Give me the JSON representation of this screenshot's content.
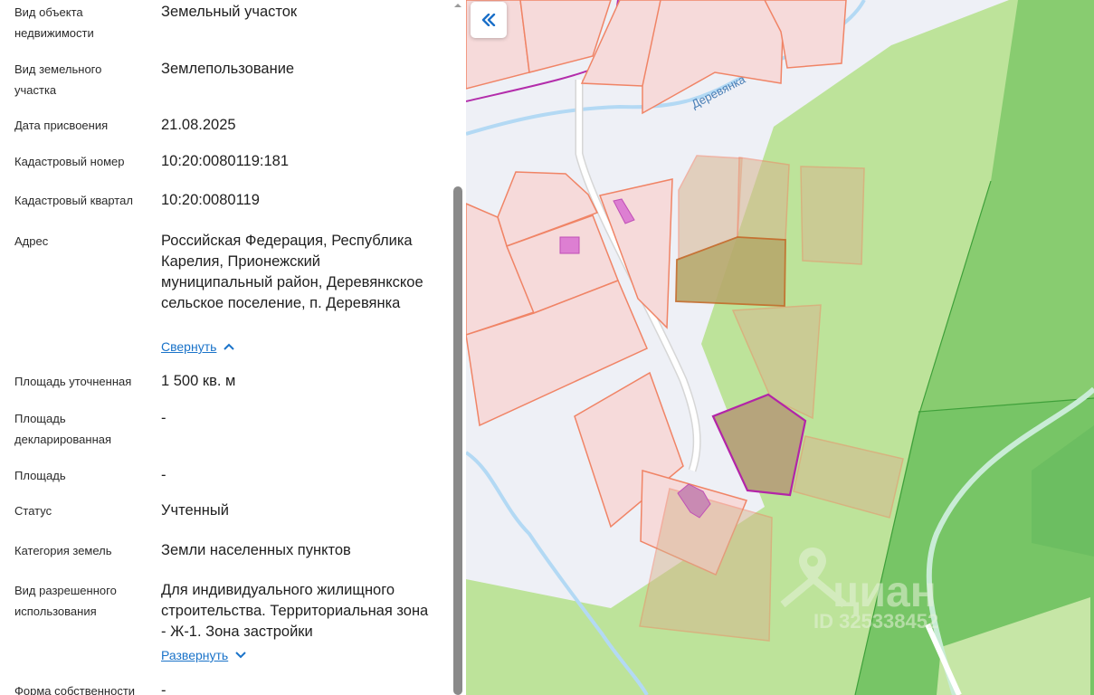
{
  "details": [
    {
      "label": "Вид объекта недвижимости",
      "value": "Земельный участок"
    },
    {
      "label": "Вид земельного участка",
      "value": "Землепользование"
    },
    {
      "label": "Дата присвоения",
      "value": "21.08.2025"
    },
    {
      "label": "Кадастровый номер",
      "value": "10:20:0080119:181"
    },
    {
      "label": "Кадастровый квартал",
      "value": "10:20:0080119"
    },
    {
      "label": "Адрес",
      "value": "Российская Федерация, Республика Карелия, Прионежский муниципальный район, Деревянкское сельское поселение, п. Деревянка",
      "link": "Свернуть"
    },
    {
      "label": "Площадь уточненная",
      "value": "1 500 кв. м"
    },
    {
      "label": "Площадь декларированная",
      "value": "-"
    },
    {
      "label": "Площадь",
      "value": "-"
    },
    {
      "label": "Статус",
      "value": "Учтенный"
    },
    {
      "label": "Категория земель",
      "value": "Земли населенных пунктов"
    },
    {
      "label": "Вид разрешенного использования",
      "value": "Для индивидуального жилищного строительства. Территориальная зона - Ж-1. Зона застройки",
      "link": "Развернуть"
    },
    {
      "label": "Форма собственности",
      "value": "-"
    }
  ],
  "map": {
    "river_label": "Деревянка",
    "watermark_brand": "циан",
    "watermark_id": "ID 325338452",
    "collapse_icon": "double-chevron-left-icon",
    "colors": {
      "background": "#eef0f6",
      "forest_light": "#bde39a",
      "forest_dark": "#88cc70",
      "parcel_fill": "#f6dada",
      "parcel_stroke": "#f08466",
      "selected_stroke": "#b324a8",
      "building": "#dd7fd2",
      "water": "#b3d9f4"
    }
  },
  "colors": {
    "link": "#1a73c9",
    "scrollbar_thumb": "#8a8a8a"
  }
}
